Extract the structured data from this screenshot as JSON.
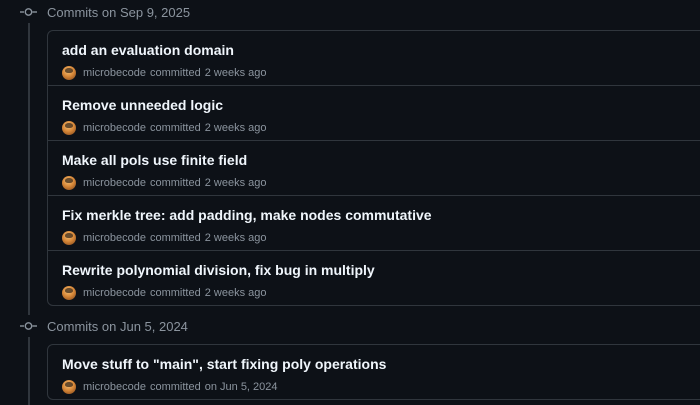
{
  "groups": [
    {
      "title": "Commits on Sep 9, 2025",
      "commits": [
        {
          "title": "add an evaluation domain",
          "author": "microbecode",
          "verb": "committed",
          "time": "2 weeks ago"
        },
        {
          "title": "Remove unneeded logic",
          "author": "microbecode",
          "verb": "committed",
          "time": "2 weeks ago"
        },
        {
          "title": "Make all pols use finite field",
          "author": "microbecode",
          "verb": "committed",
          "time": "2 weeks ago"
        },
        {
          "title": "Fix merkle tree: add padding, make nodes commutative",
          "author": "microbecode",
          "verb": "committed",
          "time": "2 weeks ago"
        },
        {
          "title": "Rewrite polynomial division, fix bug in multiply",
          "author": "microbecode",
          "verb": "committed",
          "time": "2 weeks ago"
        }
      ]
    },
    {
      "title": "Commits on Jun 5, 2024",
      "commits": [
        {
          "title": "Move stuff to \"main\", start fixing poly operations",
          "author": "microbecode",
          "verb": "committed",
          "time": "on Jun 5, 2024"
        }
      ]
    }
  ],
  "icons": {
    "group_header": "git-commit-icon",
    "avatar": "user-avatar"
  },
  "colors": {
    "background": "#0d1117",
    "border": "#30363d",
    "text_primary": "#f0f6fc",
    "text_muted": "#8b949e"
  }
}
